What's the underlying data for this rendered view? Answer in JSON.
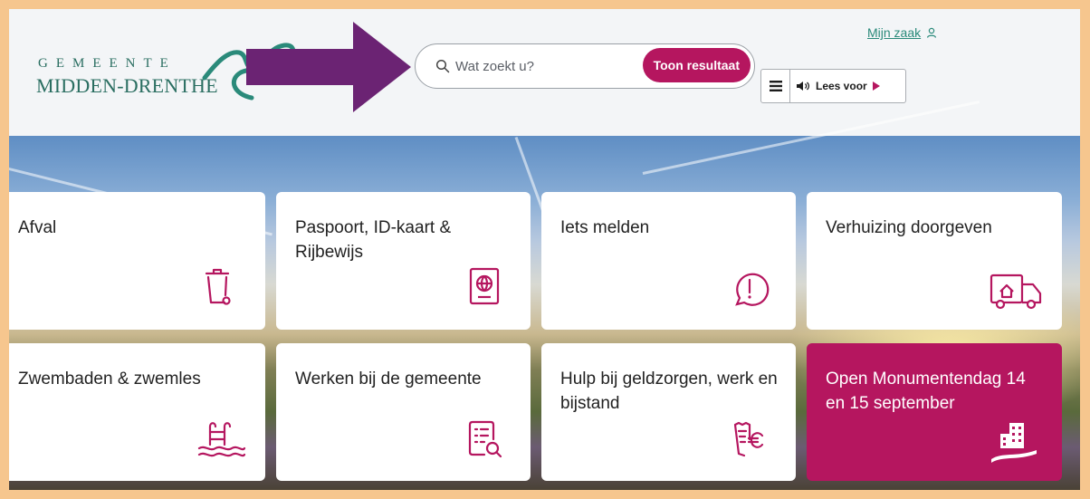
{
  "header": {
    "logo": {
      "line1": "GEMEENTE",
      "line2": "MIDDEN-DRENTHE"
    },
    "search": {
      "placeholder": "Wat zoekt u?",
      "button_label": "Toon resultaat"
    },
    "account_link": "Mijn zaak",
    "readspeaker": {
      "label": "Lees voor"
    }
  },
  "colors": {
    "brand": "#b5165f",
    "logo_green": "#2a6e61",
    "annotation_arrow": "#6b2373"
  },
  "tiles": [
    {
      "title": "Afval",
      "icon": "trash-bin-icon"
    },
    {
      "title": "Paspoort, ID-kaart & Rijbewijs",
      "icon": "passport-icon"
    },
    {
      "title": "Iets melden",
      "icon": "exclamation-circle-icon"
    },
    {
      "title": "Verhuizing doorgeven",
      "icon": "moving-truck-icon"
    },
    {
      "title": "Zwembaden & zwemles",
      "icon": "pool-ladder-icon"
    },
    {
      "title": "Werken bij de gemeente",
      "icon": "vacancy-document-icon"
    },
    {
      "title": "Hulp bij geldzorgen, werk en bijstand",
      "icon": "receipt-euro-icon"
    },
    {
      "title": "Open Monumentendag 14 en 15 september",
      "icon": "monument-building-icon"
    }
  ]
}
